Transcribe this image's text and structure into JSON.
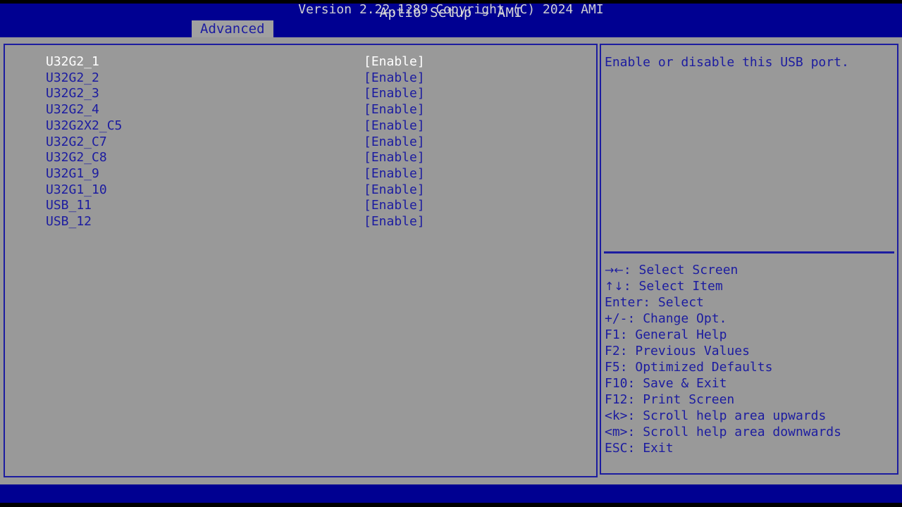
{
  "header": {
    "title": "Aptio Setup – AMI",
    "header_bg": "#000091",
    "header_text_color": "#d8d8d8"
  },
  "tabs": [
    {
      "label": "Advanced",
      "active": true
    }
  ],
  "theme": {
    "body_bg": "#999999",
    "border_color": "#1c1ca0",
    "text_color": "#1c1ca0",
    "selected_text_color": "#ffffff",
    "footer_bg": "#000091"
  },
  "settings": {
    "rows": [
      {
        "name": "U32G2_1",
        "value": "[Enable]",
        "selected": true
      },
      {
        "name": "U32G2_2",
        "value": "[Enable]",
        "selected": false
      },
      {
        "name": "U32G2_3",
        "value": "[Enable]",
        "selected": false
      },
      {
        "name": "U32G2_4",
        "value": "[Enable]",
        "selected": false
      },
      {
        "name": "U32G2X2_C5",
        "value": "[Enable]",
        "selected": false
      },
      {
        "name": "U32G2_C7",
        "value": "[Enable]",
        "selected": false
      },
      {
        "name": "U32G2_C8",
        "value": "[Enable]",
        "selected": false
      },
      {
        "name": "U32G1_9",
        "value": "[Enable]",
        "selected": false
      },
      {
        "name": "U32G1_10",
        "value": "[Enable]",
        "selected": false
      },
      {
        "name": "USB_11",
        "value": "[Enable]",
        "selected": false
      },
      {
        "name": "USB_12",
        "value": "[Enable]",
        "selected": false
      }
    ]
  },
  "help": {
    "description": "Enable or disable this USB port.",
    "keys": [
      {
        "key": "→←",
        "separator": ": ",
        "action": "Select Screen",
        "is_glyph": true
      },
      {
        "key": "↑↓",
        "separator": ": ",
        "action": "Select Item",
        "is_glyph": true
      },
      {
        "key": "Enter",
        "separator": ": ",
        "action": "Select",
        "is_glyph": false
      },
      {
        "key": "+/-",
        "separator": ": ",
        "action": "Change Opt.",
        "is_glyph": false
      },
      {
        "key": "F1",
        "separator": ": ",
        "action": "General Help",
        "is_glyph": false
      },
      {
        "key": "F2",
        "separator": ": ",
        "action": "Previous Values",
        "is_glyph": false
      },
      {
        "key": "F5",
        "separator": ": ",
        "action": "Optimized Defaults",
        "is_glyph": false
      },
      {
        "key": "F10",
        "separator": ": ",
        "action": "Save & Exit",
        "is_glyph": false
      },
      {
        "key": "F12",
        "separator": ": ",
        "action": "Print Screen",
        "is_glyph": false
      },
      {
        "key": "<k>",
        "separator": ": ",
        "action": "Scroll help area upwards",
        "is_glyph": false
      },
      {
        "key": "<m>",
        "separator": ": ",
        "action": "Scroll help area downwards",
        "is_glyph": false
      },
      {
        "key": "ESC",
        "separator": ": ",
        "action": "Exit",
        "is_glyph": false
      }
    ]
  },
  "footer": {
    "text": "Version 2.22.1289 Copyright (C) 2024 AMI"
  }
}
